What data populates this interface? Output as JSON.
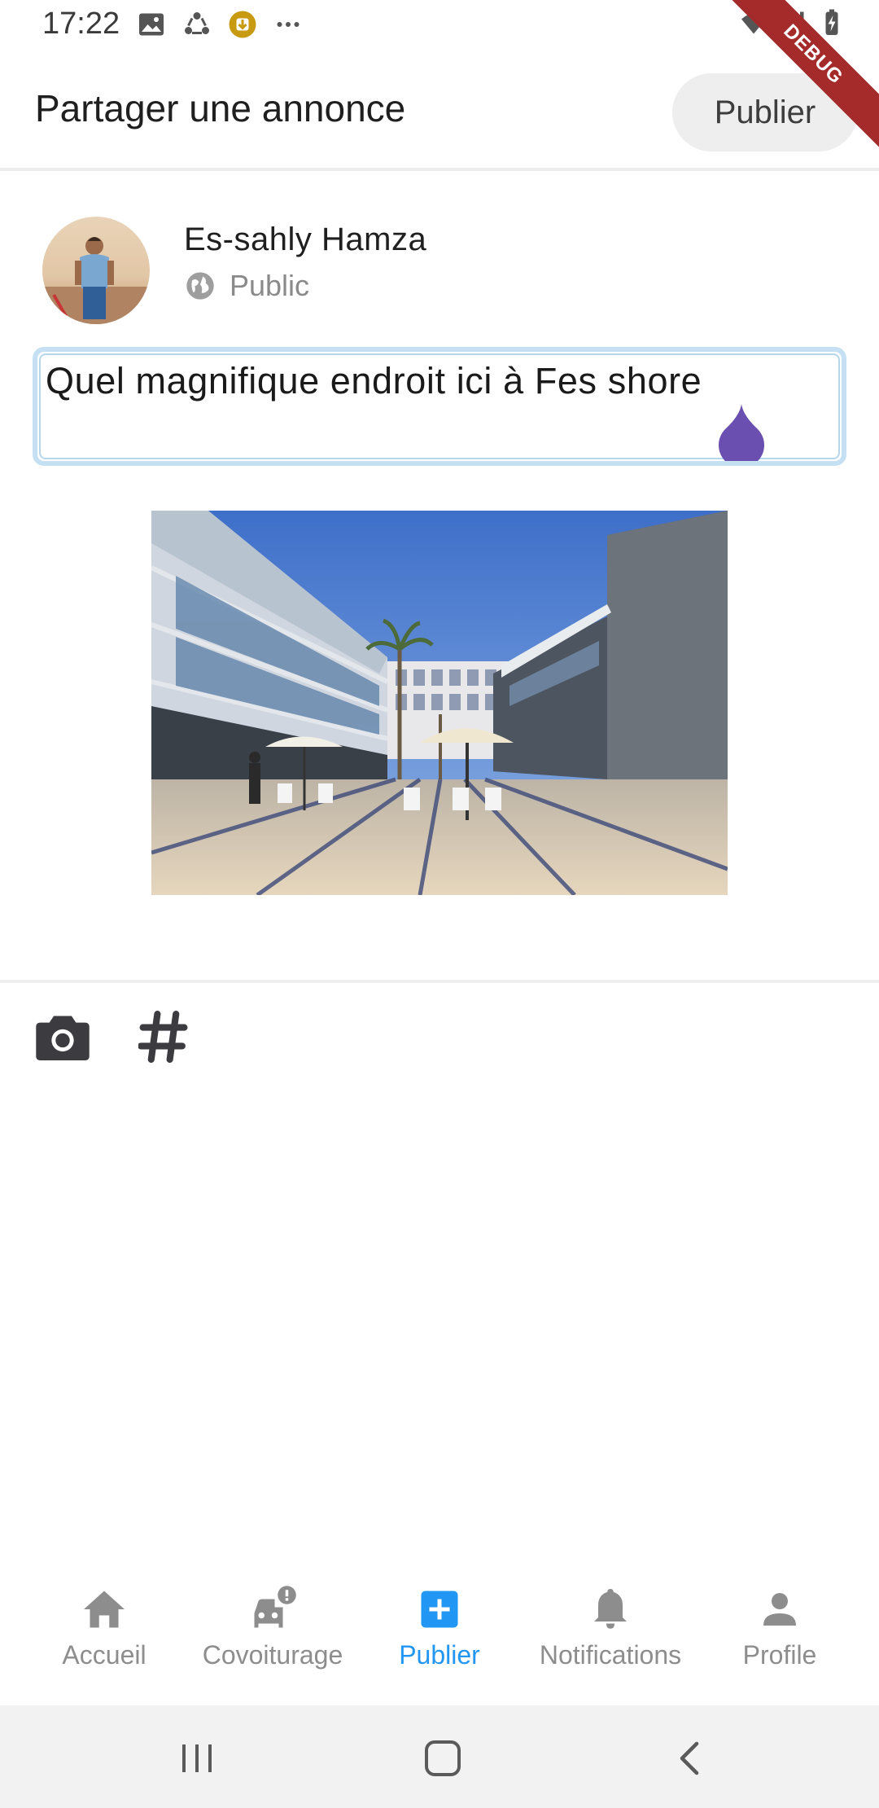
{
  "status_bar": {
    "time": "17:22"
  },
  "debug_banner": "DEBUG",
  "app_bar": {
    "title": "Partager une annonce",
    "publish_label": "Publier"
  },
  "author": {
    "name": "Es-sahly Hamza",
    "visibility": "Public"
  },
  "post": {
    "text": "Quel magnifique endroit ici à Fes shore"
  },
  "tools": [
    "camera-icon",
    "hashtag-icon"
  ],
  "bottom_nav": {
    "items": [
      {
        "label": "Accueil",
        "icon": "home-icon"
      },
      {
        "label": "Covoiturage",
        "icon": "car-alert-icon"
      },
      {
        "label": "Publier",
        "icon": "add-box-icon",
        "active": true
      },
      {
        "label": "Notifications",
        "icon": "bell-icon"
      },
      {
        "label": "Profile",
        "icon": "person-icon"
      }
    ]
  },
  "colors": {
    "accent": "#2196f3",
    "inactive": "#8d8d8d",
    "field_border": "#c5e0f3",
    "cursor_handle": "#6a4fb0",
    "debug_ribbon": "#a52a2a"
  }
}
